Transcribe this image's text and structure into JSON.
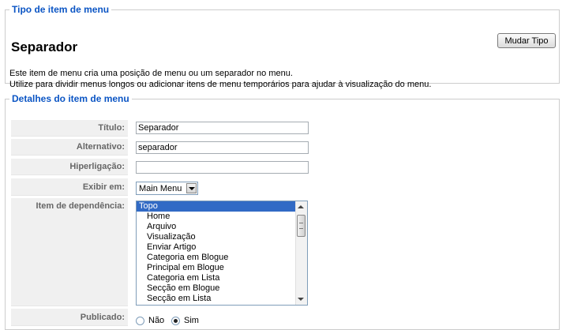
{
  "type_section": {
    "legend": "Tipo de item de menu",
    "title": "Separador",
    "change_button": "Mudar Tipo",
    "description_line1": "Este item de menu cria uma posição de menu ou um separador no menu.",
    "description_line2": "Utilize para dividir menus longos ou adicionar itens de menu temporários para ajudar à visualização do menu."
  },
  "details": {
    "legend": "Detalhes do item de menu",
    "labels": {
      "title": "Título:",
      "alias": "Alternativo:",
      "link": "Hiperligação:",
      "display_in": "Exibir em:",
      "parent": "Item de dependência:",
      "published": "Publicado:"
    },
    "title_value": "Separador",
    "alias_value": "separador",
    "link_value": "",
    "display_in_value": "Main Menu",
    "parent_items": [
      "Topo",
      "Home",
      "Arquivo",
      "Visualização",
      "Enviar Artigo",
      "Categoria em Blogue",
      "Principal em Blogue",
      "Categoria em Lista",
      "Secção em Blogue",
      "Secção em Lista"
    ],
    "parent_selected": "Topo",
    "published_no": "Não",
    "published_yes": "Sim",
    "published_value": "Sim"
  },
  "colors": {
    "legend": "#0b55c4",
    "label_bg": "#f0f0f0",
    "selection": "#316ac5"
  }
}
